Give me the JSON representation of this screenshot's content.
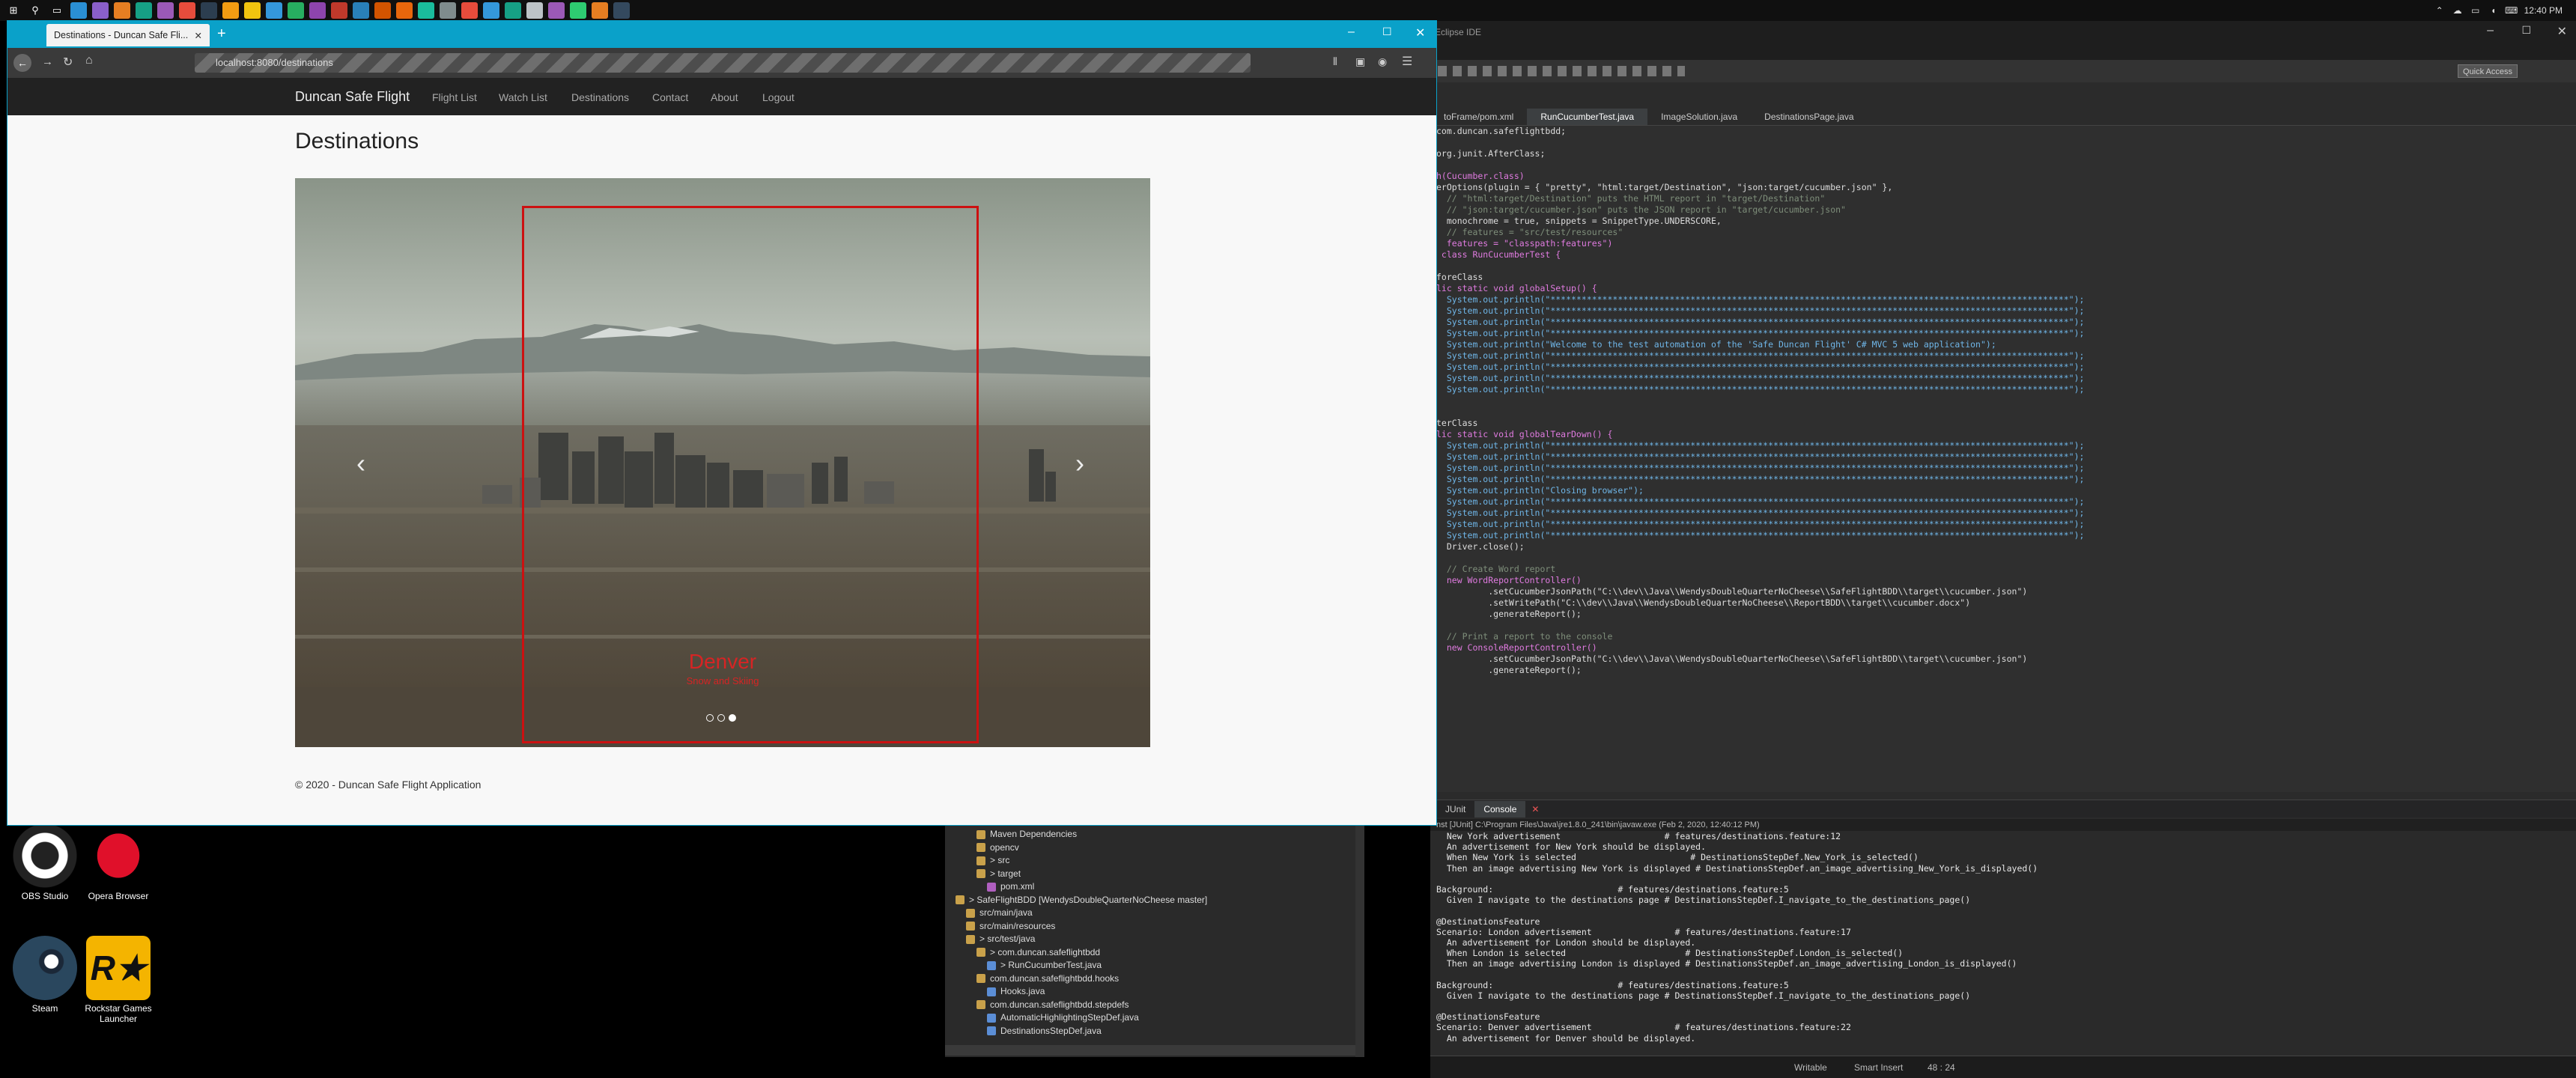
{
  "taskbar": {
    "icons": [
      "windows-logo-icon",
      "search-icon",
      "task-view-icon",
      "visual-studio-code-icon",
      "visual-studio-icon",
      "app-icon",
      "app-icon",
      "app-icon",
      "app-icon",
      "app-icon",
      "app-icon",
      "folder-icon",
      "app-icon",
      "app-icon",
      "app-icon",
      "app-icon",
      "app-icon",
      "app-icon",
      "firefox-icon",
      "app-icon",
      "app-icon",
      "app-icon",
      "app-icon",
      "app-icon",
      "app-icon",
      "app-icon",
      "app-icon",
      "app-icon",
      "app-icon"
    ],
    "clock": "12:40 PM"
  },
  "desktop": {
    "icons": [
      {
        "label": "OBS Studio",
        "icon": "obs-icon"
      },
      {
        "label": "Opera Browser",
        "icon": "opera-icon"
      },
      {
        "label": "Steam",
        "icon": "steam-icon"
      },
      {
        "label": "Rockstar Games Launcher",
        "icon": "rockstar-icon"
      }
    ]
  },
  "browser": {
    "tab_title": "Destinations - Duncan Safe Fli...",
    "url": "localhost:8080/destinations",
    "site": {
      "brand": "Duncan Safe Flight",
      "nav": [
        "Flight List",
        "Watch List",
        "Destinations",
        "Contact",
        "About",
        "Logout"
      ],
      "heading": "Destinations",
      "carousel": {
        "caption_title": "Denver",
        "caption_subtitle": "Snow and Skiing",
        "indicators": 3,
        "active_index": 2,
        "prev_label": "‹",
        "next_label": "›"
      },
      "footer": "© 2020 - Duncan Safe Flight Application"
    }
  },
  "eclipse": {
    "title": "Eclipse IDE",
    "quick_access": "Quick Access",
    "tabs": [
      "toFrame/pom.xml",
      "RunCucumberTest.java",
      "ImageSolution.java",
      "DestinationsPage.java"
    ],
    "active_tab": 1,
    "code_lines": [
      "com.duncan.safeflightbdd;",
      "",
      "org.junit.AfterClass;",
      "",
      "h(Cucumber.class)",
      "erOptions(plugin = { \"pretty\", \"html:target/Destination\", \"json:target/cucumber.json\" },",
      "  // \"html:target/Destination\" puts the HTML report in \"target/Destination\"",
      "  // \"json:target/cucumber.json\" puts the JSON report in \"target/cucumber.json\"",
      "  monochrome = true, snippets = SnippetType.UNDERSCORE,",
      "  // features = \"src/test/resources\"",
      "  features = \"classpath:features\")",
      " class RunCucumberTest {",
      "",
      "foreClass",
      "lic static void globalSetup() {",
      "  System.out.println(\"****************************************************************************************************\");",
      "  System.out.println(\"****************************************************************************************************\");",
      "  System.out.println(\"****************************************************************************************************\");",
      "  System.out.println(\"****************************************************************************************************\");",
      "  System.out.println(\"Welcome to the test automation of the 'Safe Duncan Flight' C# MVC 5 web application\");",
      "  System.out.println(\"****************************************************************************************************\");",
      "  System.out.println(\"****************************************************************************************************\");",
      "  System.out.println(\"****************************************************************************************************\");",
      "  System.out.println(\"****************************************************************************************************\");",
      "",
      "",
      "terClass",
      "lic static void globalTearDown() {",
      "  System.out.println(\"****************************************************************************************************\");",
      "  System.out.println(\"****************************************************************************************************\");",
      "  System.out.println(\"****************************************************************************************************\");",
      "  System.out.println(\"****************************************************************************************************\");",
      "  System.out.println(\"Closing browser\");",
      "  System.out.println(\"****************************************************************************************************\");",
      "  System.out.println(\"****************************************************************************************************\");",
      "  System.out.println(\"****************************************************************************************************\");",
      "  System.out.println(\"****************************************************************************************************\");",
      "  Driver.close();",
      "",
      "  // Create Word report",
      "  new WordReportController()",
      "          .setCucumberJsonPath(\"C:\\\\dev\\\\Java\\\\WendysDoubleQuarterNoCheese\\\\SafeFlightBDD\\\\target\\\\cucumber.json\")",
      "          .setWritePath(\"C:\\\\dev\\\\Java\\\\WendysDoubleQuarterNoCheese\\\\ReportBDD\\\\target\\\\cucumber.docx\")",
      "          .generateReport();",
      "",
      "  // Print a report to the console",
      "  new ConsoleReportController()",
      "          .setCucumberJsonPath(\"C:\\\\dev\\\\Java\\\\WendysDoubleQuarterNoCheese\\\\SafeFlightBDD\\\\target\\\\cucumber.json\")",
      "          .generateReport();"
    ],
    "console_tabs": [
      "JUnit",
      "Console"
    ],
    "console_path": "nst [JUnit] C:\\Program Files\\Java\\jre1.8.0_241\\bin\\javaw.exe (Feb 2, 2020, 12:40:12 PM)",
    "console_lines": [
      "  New York advertisement                    # features/destinations.feature:12",
      "  An advertisement for New York should be displayed.",
      "  When New York is selected                      # DestinationsStepDef.New_York_is_selected()",
      "  Then an image advertising New York is displayed # DestinationsStepDef.an_image_advertising_New_York_is_displayed()",
      "",
      "Background:                        # features/destinations.feature:5",
      "  Given I navigate to the destinations page # DestinationsStepDef.I_navigate_to_the_destinations_page()",
      "",
      "@DestinationsFeature",
      "Scenario: London advertisement                # features/destinations.feature:17",
      "  An advertisement for London should be displayed.",
      "  When London is selected                       # DestinationsStepDef.London_is_selected()",
      "  Then an image advertising London is displayed # DestinationsStepDef.an_image_advertising_London_is_displayed()",
      "",
      "Background:                        # features/destinations.feature:5",
      "  Given I navigate to the destinations page # DestinationsStepDef.I_navigate_to_the_destinations_page()",
      "",
      "@DestinationsFeature",
      "Scenario: Denver advertisement                # features/destinations.feature:22",
      "  An advertisement for Denver should be displayed."
    ],
    "explorer_items": [
      {
        "label": "Maven Dependencies",
        "indent": 2,
        "color": "#c9a14a"
      },
      {
        "label": "opencv",
        "indent": 2,
        "color": "#c9a14a"
      },
      {
        "label": "> src",
        "indent": 2,
        "color": "#c9a14a"
      },
      {
        "label": "> target",
        "indent": 2,
        "color": "#c9a14a"
      },
      {
        "label": "pom.xml",
        "indent": 3,
        "color": "#b05fc0"
      },
      {
        "label": "> SafeFlightBDD [WendysDoubleQuarterNoCheese master]",
        "indent": 0,
        "color": "#c9a14a"
      },
      {
        "label": "src/main/java",
        "indent": 1,
        "color": "#c9a14a"
      },
      {
        "label": "src/main/resources",
        "indent": 1,
        "color": "#c9a14a"
      },
      {
        "label": "> src/test/java",
        "indent": 1,
        "color": "#c9a14a"
      },
      {
        "label": "> com.duncan.safeflightbdd",
        "indent": 2,
        "color": "#c9a14a"
      },
      {
        "label": "> RunCucumberTest.java",
        "indent": 3,
        "color": "#5b8ed6"
      },
      {
        "label": "com.duncan.safeflightbdd.hooks",
        "indent": 2,
        "color": "#c9a14a"
      },
      {
        "label": "Hooks.java",
        "indent": 3,
        "color": "#5b8ed6"
      },
      {
        "label": "com.duncan.safeflightbdd.stepdefs",
        "indent": 2,
        "color": "#c9a14a"
      },
      {
        "label": "AutomaticHighlightingStepDef.java",
        "indent": 3,
        "color": "#5b8ed6"
      },
      {
        "label": "DestinationsStepDef.java",
        "indent": 3,
        "color": "#5b8ed6"
      }
    ],
    "status": {
      "writable": "Writable",
      "insert": "Smart Insert",
      "position": "48 : 24"
    }
  },
  "colors": {
    "firefox_accent": "#0aa1c9",
    "navbar_bg": "#222222",
    "caption_red": "#d62424",
    "highlight_border": "#cc1111"
  }
}
